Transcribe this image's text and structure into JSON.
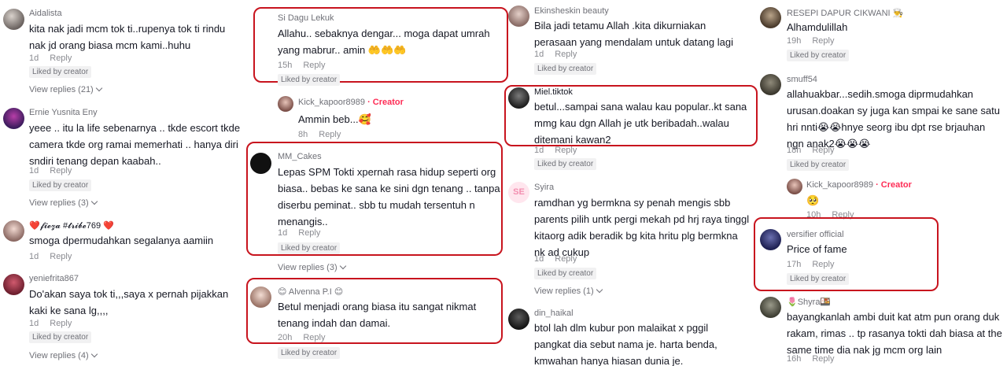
{
  "columns": [
    [
      {
        "user": "Aidalista",
        "text": "kita nak jadi mcm tok ti..rupenya tok ti rindu nak jd orang biasa mcm kami..huhu",
        "time": "1d",
        "reply": "Reply",
        "liked": "Liked by creator",
        "view_replies": "View replies (21)"
      },
      {
        "user": "Ernie Yusnita Eny",
        "text": "yeee .. itu la life sebenarnya .. tkde escort tkde camera tkde org ramai memerhati .. hanya diri sndiri tenang depan kaabah..",
        "time": "1d",
        "reply": "Reply",
        "liked": "Liked by creator",
        "view_replies": "View replies (3)"
      },
      {
        "user": "❤️𝓯𝓲𝓮𝔃𝓪 #𝓽𝓻𝓲𝓫𝓮769 ❤️",
        "text": "smoga dpermudahkan segalanya aamiin",
        "time": "1d",
        "reply": "Reply"
      },
      {
        "user": "yeniefrita867",
        "text": "Do'akan saya tok ti,,,saya x pernah pijakkan kaki ke sana lg,,,,",
        "time": "1d",
        "reply": "Reply",
        "liked": "Liked by creator",
        "view_replies": "View replies (4)"
      }
    ],
    [
      {
        "user": "Si Dagu Lekuk",
        "text": "Allahu.. sebaknya dengar... moga dapat umrah yang mabrur.. amin 🤲🤲🤲",
        "time": "15h",
        "reply": "Reply",
        "liked": "Liked by creator"
      },
      {
        "user": "Kick_kapoor8989",
        "creator": "· Creator",
        "text": "Ammin beb...🥰",
        "time": "8h",
        "reply": "Reply"
      },
      {
        "user": "MM_Cakes",
        "text": "Lepas SPM Tokti xpernah rasa hidup seperti org biasa.. bebas ke sana ke sini dgn tenang .. tanpa diserbu peminat.. sbb tu mudah tersentuh n menangis..",
        "time": "1d",
        "reply": "Reply",
        "liked": "Liked by creator",
        "view_replies": "View replies (3)"
      },
      {
        "user": "😊 Alvenna P.I 😊",
        "text": "Betul menjadi orang biasa itu sangat nikmat tenang indah dan damai.",
        "time": "20h",
        "reply": "Reply",
        "liked": "Liked by creator"
      }
    ],
    [
      {
        "user": "Ekinsheskin beauty",
        "text": "Bila jadi tetamu Allah .kita dikurniakan perasaan yang mendalam untuk datang lagi",
        "time": "1d",
        "reply": "Reply",
        "liked": "Liked by creator"
      },
      {
        "user": "Miel.tiktok",
        "text": "betul...sampai sana walau kau popular..kt sana mmg kau dgn Allah je utk beribadah..walau ditemani kawan2",
        "time": "1d",
        "reply": "Reply",
        "liked": "Liked by creator"
      },
      {
        "user": "Syira",
        "text": "ramdhan yg bermkna sy penah mengis sbb parents pilih untk pergi mekah pd hrj raya tinggl kitaorg adik beradik bg kita hritu plg bermkna nk ad cukup",
        "time": "1d",
        "reply": "Reply",
        "liked": "Liked by creator",
        "view_replies": "View replies (1)",
        "avatar_text": "SE"
      },
      {
        "user": "din_haikal",
        "text": "btol lah dlm kubur pon malaikat x pggil pangkat dia sebut nama je. harta benda, kmwahan hanya hiasan dunia je."
      }
    ],
    [
      {
        "user": "RESEPI DAPUR CIKWANI 👨‍🍳",
        "text": "Alhamdulillah",
        "time": "19h",
        "reply": "Reply",
        "liked": "Liked by creator"
      },
      {
        "user": "smuff54",
        "text": "allahuakbar...sedih.smoga diprmudahkan urusan.doakan sy juga kan smpai ke sane satu hri nnti😭😭hnye seorg ibu dpt rse brjauhan ngn anak2😭😭😭",
        "time": "18h",
        "reply": "Reply",
        "liked": "Liked by creator"
      },
      {
        "user": "Kick_kapoor8989",
        "creator": "· Creator",
        "text": "🥺",
        "time": "10h",
        "reply": "Reply"
      },
      {
        "user": "versifier official",
        "text": "Price of fame",
        "time": "17h",
        "reply": "Reply",
        "liked": "Liked by creator"
      },
      {
        "user": "🌷Shyra🍱",
        "text": "bayangkanlah ambi duit kat atm pun orang duk rakam, rimas .. tp rasanya tokti dah biasa at the same time dia nak jg mcm org lain",
        "time": "16h",
        "reply": "Reply"
      }
    ]
  ],
  "colors": {
    "highlight": "#c8141e",
    "creator": "#fe2c55",
    "text": "#161823",
    "muted": "#8a8b91"
  }
}
